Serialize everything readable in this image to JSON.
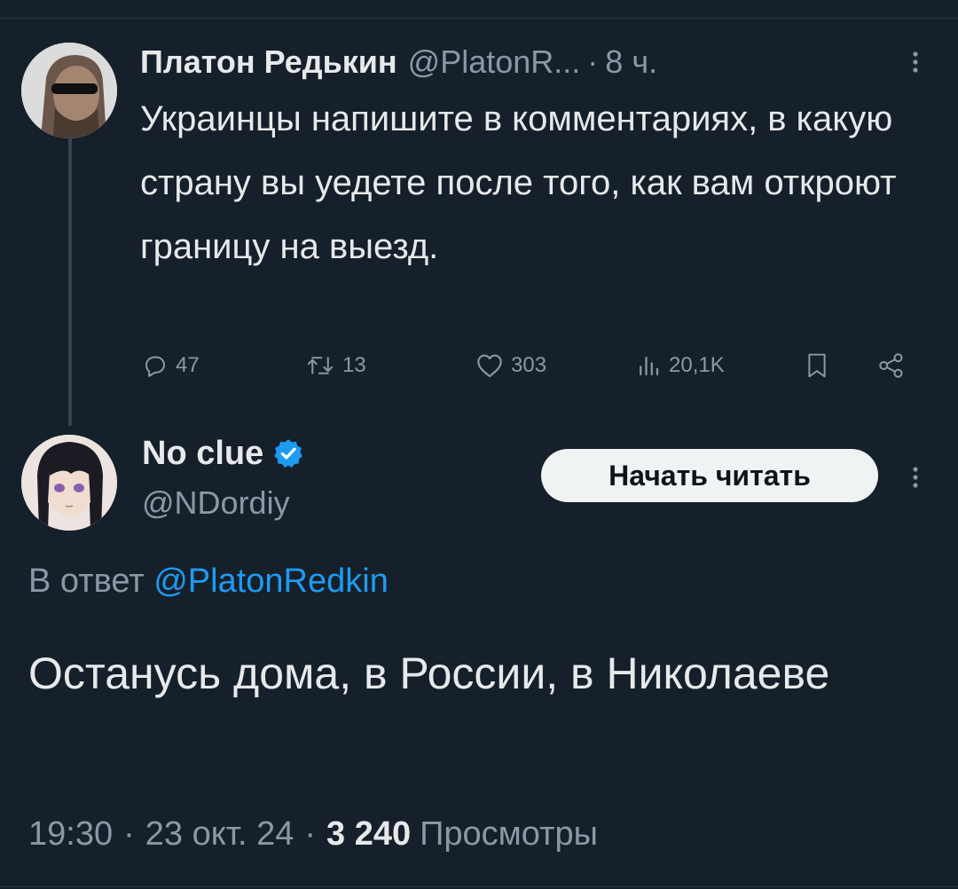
{
  "parent_tweet": {
    "author_name": "Платон Редькин",
    "handle": "@PlatonR...",
    "separator": "·",
    "time": "8 ч.",
    "text": "Украинцы напишите в комментариях, в какую страну вы уедете после того, как вам откроют границу на выезд.",
    "actions": {
      "replies": "47",
      "retweets": "13",
      "likes": "303",
      "views": "20,1K"
    }
  },
  "reply_tweet": {
    "author_name": "No clue",
    "handle": "@NDordiy",
    "follow_label": "Начать читать",
    "reply_to_prefix": "В ответ",
    "reply_to_handle": "@PlatonRedkin",
    "text": "Останусь дома, в России, в Николаеве",
    "time": "19:30",
    "separator": "·",
    "date": "23 окт. 24",
    "views_count": "3 240",
    "views_label": "Просмотры"
  },
  "icons": {
    "reply": "reply-icon",
    "retweet": "retweet-icon",
    "like": "heart-icon",
    "views": "views-icon",
    "bookmark": "bookmark-icon",
    "share": "share-icon",
    "more": "more-vertical-icon",
    "verified": "verified-badge-icon"
  },
  "colors": {
    "background": "#15202b",
    "text": "#e7e9ea",
    "muted": "#8b98a5",
    "link": "#1d9bf0",
    "verified": "#1d9bf0"
  }
}
